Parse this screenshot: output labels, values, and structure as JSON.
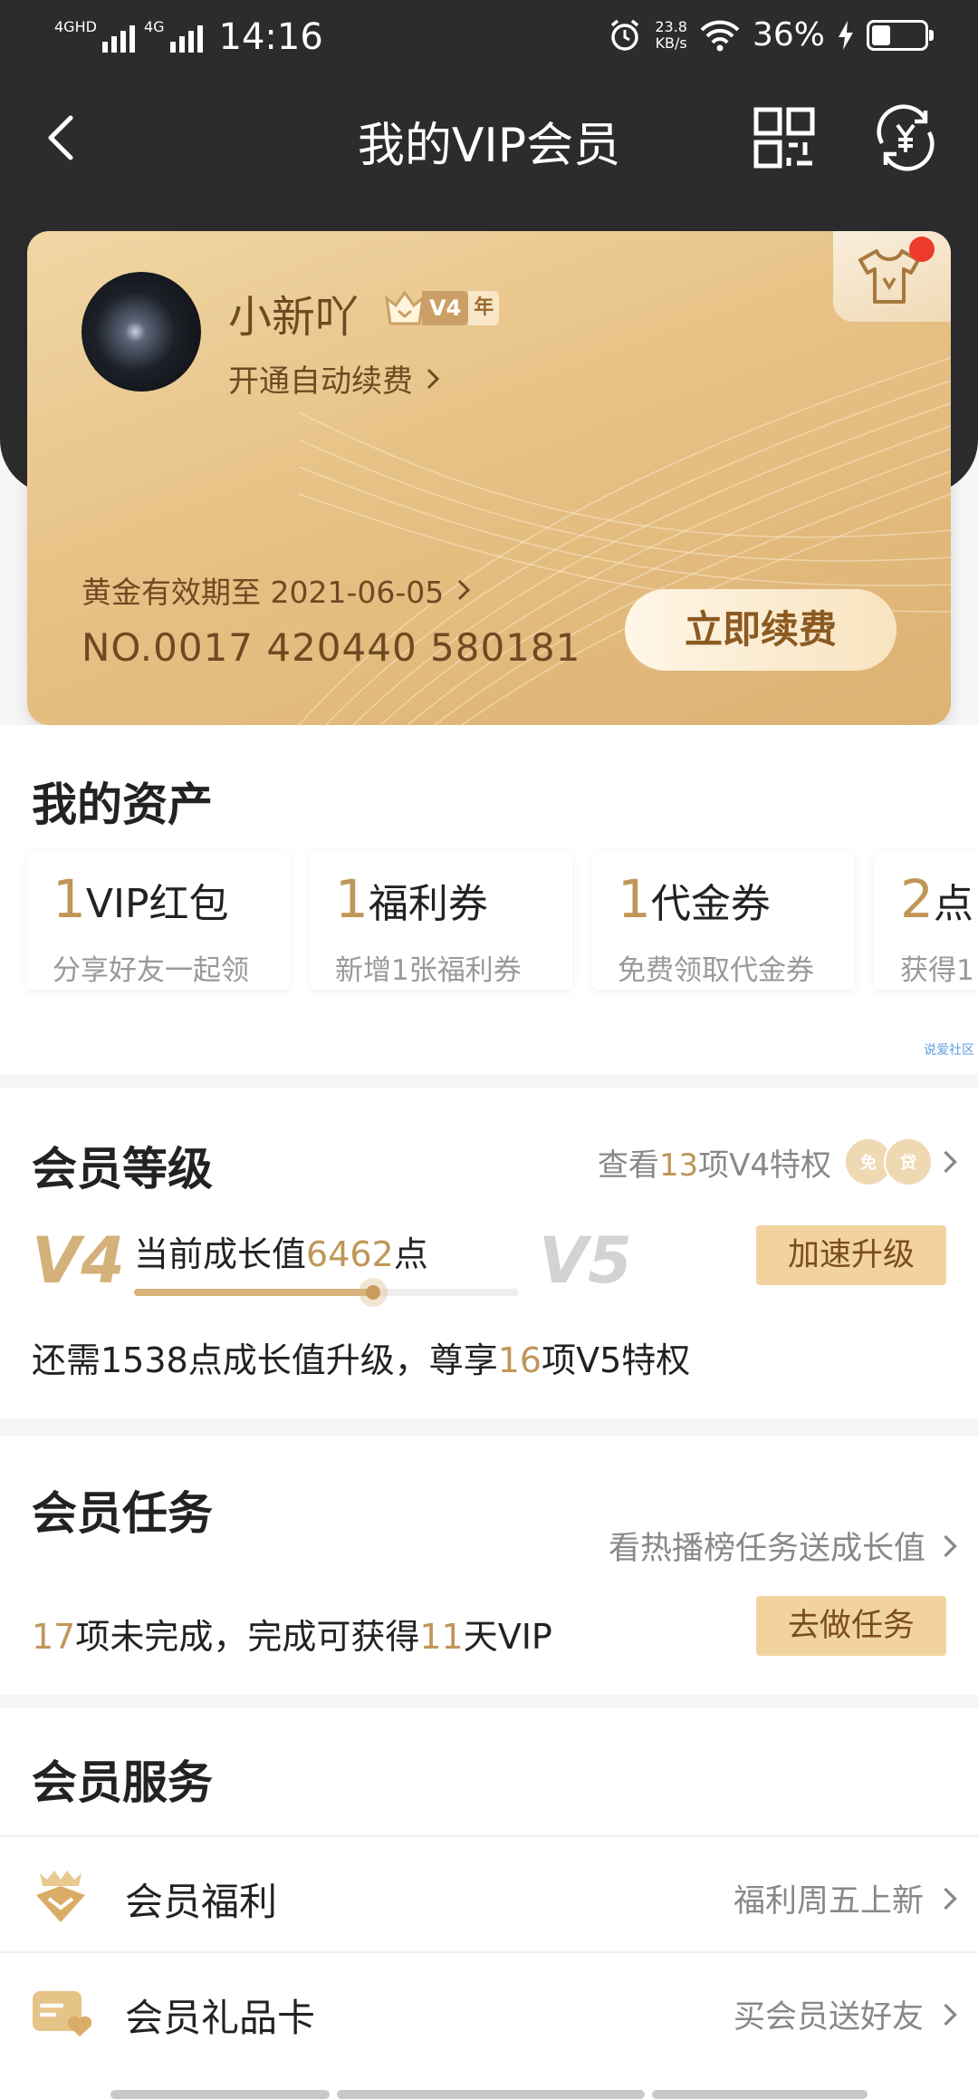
{
  "status_bar": {
    "network1": "4GHD",
    "network2": "4G",
    "time": "14:16",
    "speed_value": "23.8",
    "speed_unit": "KB/s",
    "battery": "36%"
  },
  "nav": {
    "title": "我的VIP会员"
  },
  "card": {
    "username": "小新吖",
    "vip_level": "V4",
    "vip_year": "年",
    "auto_renew": "开通自动续费",
    "valid_until": "黄金有效期至 2021-06-05",
    "card_number": "NO.0017 420440 580181",
    "renew_button": "立即续费"
  },
  "assets": {
    "title": "我的资产",
    "items": [
      {
        "count": "1",
        "name": "VIP红包",
        "desc": "分享好友一起领"
      },
      {
        "count": "1",
        "name": "福利券",
        "desc": "新增1张福利券"
      },
      {
        "count": "1",
        "name": "代金券",
        "desc": "免费领取代金券"
      },
      {
        "count": "2",
        "name": "点",
        "desc": "获得1"
      }
    ],
    "watermark": "说爱社区"
  },
  "level": {
    "title": "会员等级",
    "link_prefix": "查看",
    "link_count": "13",
    "link_suffix": "项V4特权",
    "icon1": "免",
    "icon2": "贷",
    "current_level": "V4",
    "next_level": "V5",
    "growth_prefix": "当前成长值",
    "growth_value": "6462",
    "growth_suffix": "点",
    "progress": 0.62,
    "speed_button": "加速升级",
    "desc_prefix": "还需1538点成长值升级，尊享",
    "desc_count": "16",
    "desc_suffix": "项V5特权"
  },
  "tasks": {
    "title": "会员任务",
    "link": "看热播榜任务送成长值",
    "desc_count1": "17",
    "desc_mid": "项未完成，完成可获得",
    "desc_count2": "11",
    "desc_suffix": "天VIP",
    "button": "去做任务"
  },
  "services": {
    "title": "会员服务",
    "items": [
      {
        "label": "会员福利",
        "right": "福利周五上新",
        "icon": "gift-crown-icon"
      },
      {
        "label": "会员礼品卡",
        "right": "买会员送好友",
        "icon": "gift-card-icon"
      }
    ]
  },
  "colors": {
    "dark_header": "#2c2c2f",
    "gold": "#c09658",
    "gold_button": "#f2d3a0",
    "red_dot": "#ee3b2d"
  }
}
